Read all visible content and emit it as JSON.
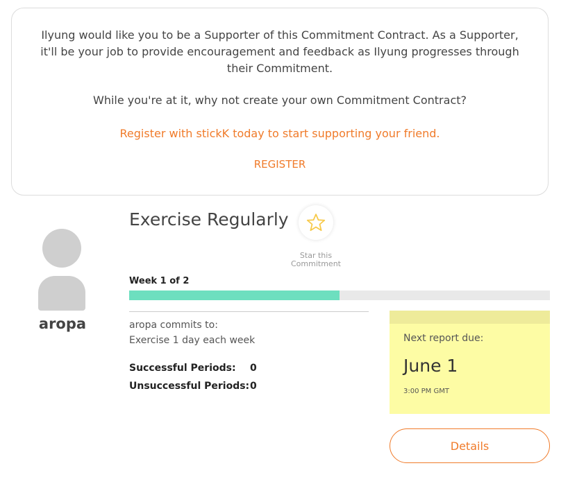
{
  "notice": {
    "message": "Ilyung would like you to be a Supporter of this Commitment Contract. As a Supporter, it'll be your job to provide encouragement and feedback as Ilyung progresses through their Commitment.",
    "question": "While you're at it, why not create your own Commitment Contract?",
    "cta": "Register with stickK today to start supporting your friend.",
    "register_label": "REGISTER"
  },
  "user": {
    "name": "aropa"
  },
  "commitment": {
    "title": "Exercise Regularly",
    "star_label": "Star this Commitment",
    "star_icon": "star-icon",
    "week_label": "Week 1 of 2",
    "progress_fraction": 0.5,
    "commits_to_label": "aropa commits to:",
    "goal": "Exercise 1 day each week",
    "successful_label": "Successful Periods:",
    "successful_value": "0",
    "unsuccessful_label": "Unsuccessful Periods:",
    "unsuccessful_value": "0"
  },
  "report": {
    "label": "Next report due:",
    "date": "June 1",
    "time": "3:00 PM GMT"
  },
  "details_label": "Details",
  "colors": {
    "accent": "#f07b2a",
    "progress": "#6ddfbf",
    "note": "#fdfca4",
    "star": "#f7c948"
  }
}
